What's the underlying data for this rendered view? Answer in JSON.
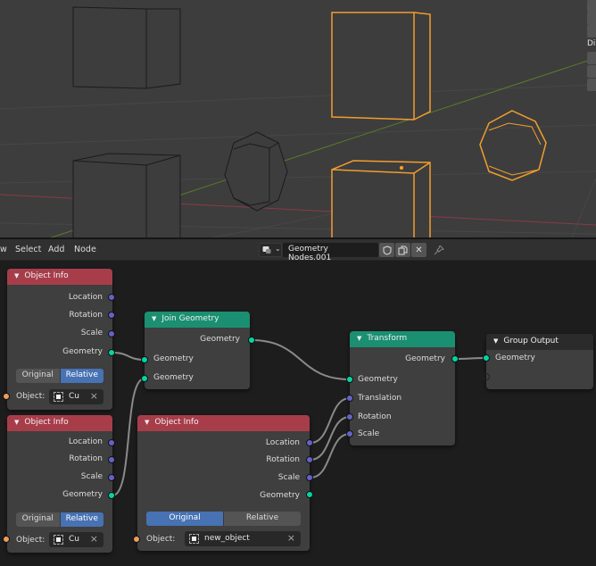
{
  "viewport": {
    "side_panel_label": "Di"
  },
  "header": {
    "menu": [
      "w",
      "Select",
      "Add",
      "Node"
    ],
    "tree_name": "Geometry Nodes.001",
    "icons": [
      "editor-type-icon",
      "fake-user-shield-icon",
      "duplicate-icon",
      "unlink-x-icon",
      "pin-icon"
    ]
  },
  "nodes": {
    "object_info_1": {
      "title": "Object Info",
      "outputs": [
        "Location",
        "Rotation",
        "Scale",
        "Geometry"
      ],
      "toggle": [
        "Original",
        "Relative"
      ],
      "toggle_active": "Relative",
      "object_label": "Object:",
      "object_value": "Cu"
    },
    "object_info_2": {
      "title": "Object Info",
      "outputs": [
        "Location",
        "Rotation",
        "Scale",
        "Geometry"
      ],
      "toggle": [
        "Original",
        "Relative"
      ],
      "toggle_active": "Relative",
      "object_label": "Object:",
      "object_value": "Cu"
    },
    "object_info_3": {
      "title": "Object Info",
      "outputs": [
        "Location",
        "Rotation",
        "Scale",
        "Geometry"
      ],
      "toggle": [
        "Original",
        "Relative"
      ],
      "toggle_active": "Original",
      "object_label": "Object:",
      "object_value": "new_object"
    },
    "join_geometry": {
      "title": "Join Geometry",
      "output": "Geometry",
      "inputs": [
        "Geometry",
        "Geometry"
      ]
    },
    "transform": {
      "title": "Transform",
      "output": "Geometry",
      "inputs": [
        "Geometry",
        "Translation",
        "Rotation",
        "Scale"
      ]
    },
    "group_output": {
      "title": "Group Output",
      "inputs": [
        "Geometry"
      ]
    }
  },
  "colors": {
    "geometry_socket": "#00d6a3",
    "vector_socket": "#6363c7",
    "object_socket": "#ed9e5c",
    "input_node_header": "#a83d4a",
    "geometry_node_header": "#1a8f71",
    "selection": "#f29d2e",
    "active_toggle": "#4772b3"
  }
}
